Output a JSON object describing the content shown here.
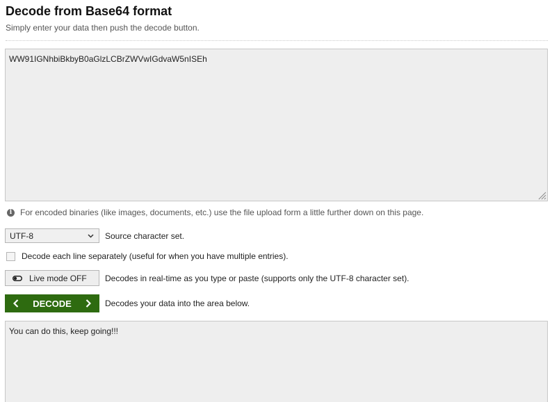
{
  "header": {
    "title": "Decode from Base64 format",
    "subtitle": "Simply enter your data then push the decode button."
  },
  "source": {
    "value": "WW91IGNhbiBkbyB0aGlzLCBrZWVwIGdvaW5nISEh"
  },
  "info": {
    "text": "For encoded binaries (like images, documents, etc.) use the file upload form a little further down on this page."
  },
  "charset": {
    "selected": "UTF-8",
    "label": "Source character set."
  },
  "each_line": {
    "label": "Decode each line separately (useful for when you have multiple entries)."
  },
  "live_mode": {
    "button_label": "Live mode OFF",
    "description": "Decodes in real-time as you type or paste (supports only the UTF-8 character set)."
  },
  "decode": {
    "button_label": "DECODE",
    "description": "Decodes your data into the area below."
  },
  "output": {
    "value": "You can do this, keep going!!!"
  },
  "colors": {
    "decode_button": "#2e6b10",
    "textarea_bg": "#eeeeee"
  }
}
